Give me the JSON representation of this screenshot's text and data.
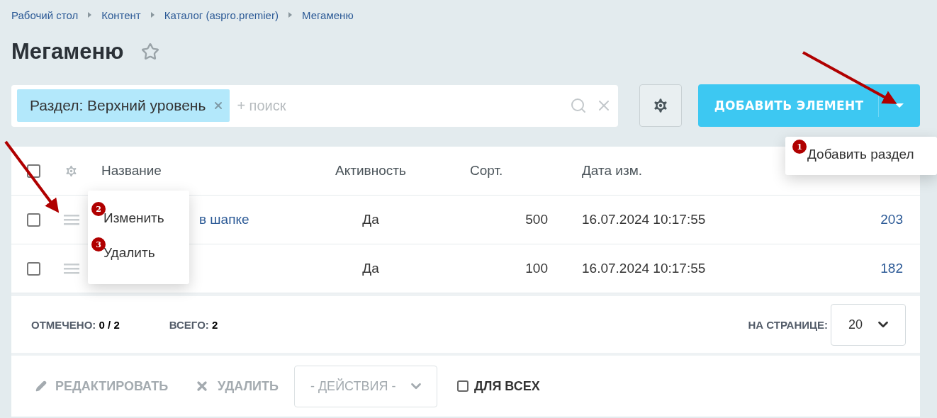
{
  "breadcrumbs": [
    "Рабочий стол",
    "Контент",
    "Каталог (aspro.premier)",
    "Мегаменю"
  ],
  "title": "Мегаменю",
  "favorite": false,
  "filter": {
    "tag": "Раздел: Верхний уровень",
    "placeholder": "+ поиск"
  },
  "add_button": {
    "label": "ДОБАВИТЬ ЭЛЕМЕНТ",
    "menu": [
      {
        "badge": "1",
        "label": "Добавить раздел"
      }
    ]
  },
  "table": {
    "all_checked": false,
    "columns": [
      "Название",
      "Активность",
      "Сорт.",
      "Дата изм."
    ],
    "rows": [
      {
        "checked": false,
        "name": "в шапке",
        "active": "Да",
        "sort": "500",
        "date": "16.07.2024 10:17:55",
        "id": "203"
      },
      {
        "checked": false,
        "active": "Да",
        "sort": "100",
        "date": "16.07.2024 10:17:55",
        "id": "182"
      }
    ],
    "row_menu": [
      {
        "badge": "2",
        "label": "Изменить"
      },
      {
        "badge": "3",
        "label": "Удалить"
      }
    ]
  },
  "summary": {
    "checked_label": "ОТМЕЧЕНО:",
    "checked_value": "0 / 2",
    "total_label": "ВСЕГО:",
    "total_value": "2",
    "per_page_label": "НА СТРАНИЦЕ:",
    "per_page": "20"
  },
  "actions": {
    "edit": "РЕДАКТИРОВАТЬ",
    "delete": "УДАЛИТЬ",
    "select": "- ДЕЙСТВИЯ -",
    "for_all": {
      "label": "ДЛЯ ВСЕХ",
      "checked": false
    }
  }
}
